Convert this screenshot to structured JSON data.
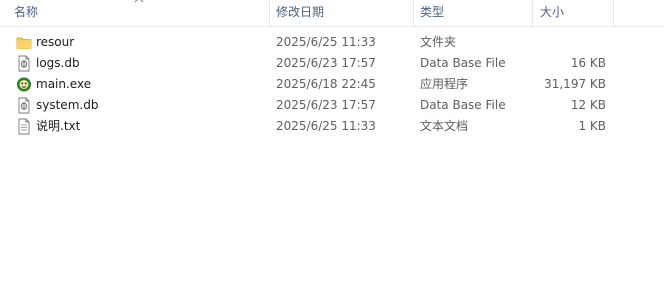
{
  "columns": {
    "name": "名称",
    "date": "修改日期",
    "type": "类型",
    "size": "大小"
  },
  "files": [
    {
      "icon": "folder-icon",
      "name": "resour",
      "date": "2025/6/25 11:33",
      "type": "文件夹",
      "size": ""
    },
    {
      "icon": "database-file-icon",
      "name": "logs.db",
      "date": "2025/6/23 17:57",
      "type": "Data Base File",
      "size": "16 KB"
    },
    {
      "icon": "application-icon",
      "name": "main.exe",
      "date": "2025/6/18 22:45",
      "type": "应用程序",
      "size": "31,197 KB"
    },
    {
      "icon": "database-file-icon",
      "name": "system.db",
      "date": "2025/6/23 17:57",
      "type": "Data Base File",
      "size": "12 KB"
    },
    {
      "icon": "text-file-icon",
      "name": "说明.txt",
      "date": "2025/6/25 11:33",
      "type": "文本文档",
      "size": "1 KB"
    }
  ],
  "colors": {
    "header_text": "#4d6082",
    "folder": "#f6c752",
    "exe_icon": "#2f7d2f"
  }
}
